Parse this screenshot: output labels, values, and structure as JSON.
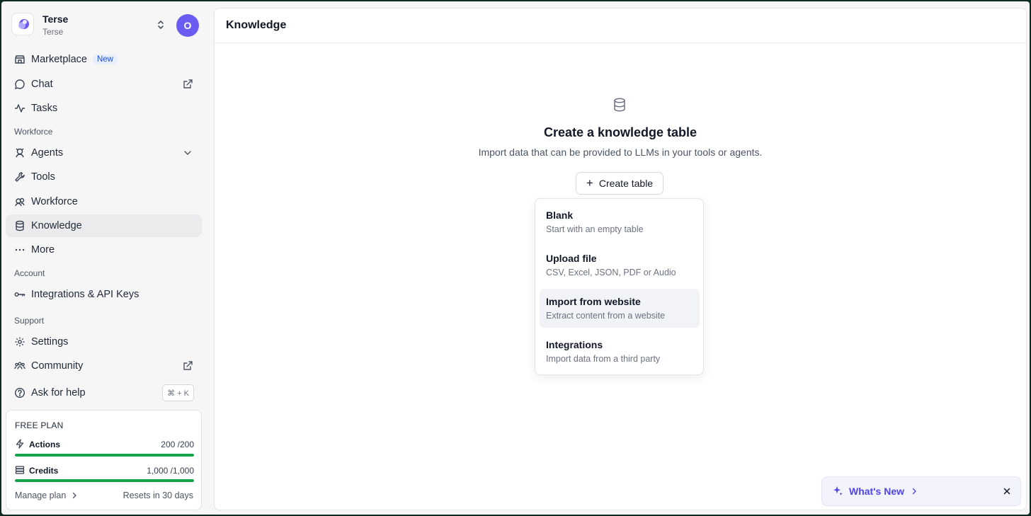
{
  "workspace": {
    "name": "Terse",
    "subtitle": "Terse",
    "avatar_initial": "O"
  },
  "sidebar": {
    "items_top": [
      {
        "label": "Marketplace",
        "badge": "New",
        "icon": "store-icon"
      },
      {
        "label": "Chat",
        "icon": "chat-bubble-icon",
        "right_icon": "external-link-icon"
      },
      {
        "label": "Tasks",
        "icon": "activity-icon"
      }
    ],
    "section_workforce": "Workforce",
    "items_workforce": [
      {
        "label": "Agents",
        "icon": "agent-icon",
        "right_icon": "chevron-down-icon"
      },
      {
        "label": "Tools",
        "icon": "wrench-icon"
      },
      {
        "label": "Workforce",
        "icon": "workforce-icon"
      },
      {
        "label": "Knowledge",
        "icon": "database-icon",
        "active": true
      },
      {
        "label": "More",
        "icon": "more-dots-icon"
      }
    ],
    "section_account": "Account",
    "items_account": [
      {
        "label": "Integrations & API Keys",
        "icon": "key-icon"
      }
    ],
    "section_support": "Support",
    "items_support": [
      {
        "label": "Settings",
        "icon": "gear-icon"
      },
      {
        "label": "Community",
        "icon": "community-icon",
        "right_icon": "external-link-icon"
      },
      {
        "label": "Ask for help",
        "icon": "help-circle-icon",
        "shortcut": "⌘ + K"
      }
    ]
  },
  "plan": {
    "title": "FREE PLAN",
    "actions": {
      "label": "Actions",
      "value": "200 /200",
      "fill": 1.0
    },
    "credits": {
      "label": "Credits",
      "value": "1,000 /1,000",
      "fill": 1.0
    },
    "manage_label": "Manage plan",
    "reset_label": "Resets in 30 days"
  },
  "main": {
    "title": "Knowledge",
    "empty_title": "Create a knowledge table",
    "empty_subtitle": "Import data that can be provided to LLMs in your tools or agents.",
    "create_button": "Create table",
    "menu": [
      {
        "title": "Blank",
        "desc": "Start with an empty table"
      },
      {
        "title": "Upload file",
        "desc": "CSV, Excel, JSON, PDF or Audio"
      },
      {
        "title": "Import from website",
        "desc": "Extract content from a website",
        "hovered": true
      },
      {
        "title": "Integrations",
        "desc": "Import data from a third party"
      }
    ]
  },
  "whats_new": {
    "label": "What's New"
  },
  "colors": {
    "accent": "#6a5cf0",
    "meter": "#16a34a",
    "link": "#4f46e5"
  }
}
